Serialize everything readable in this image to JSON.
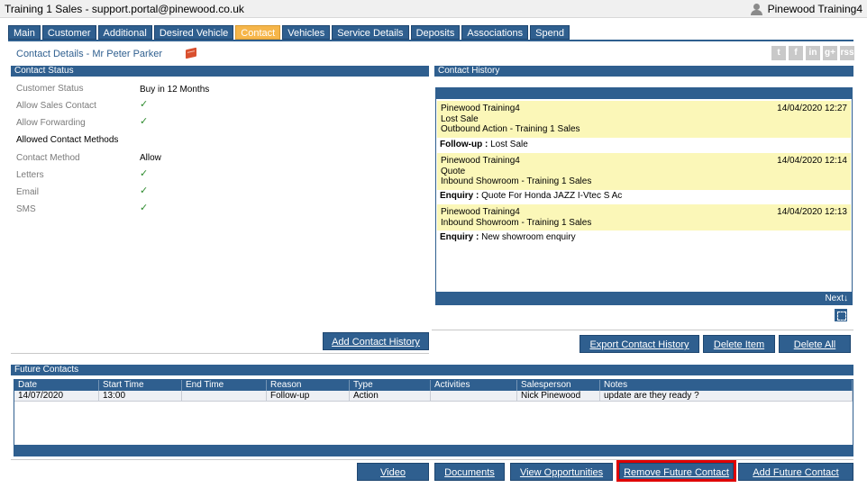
{
  "window": {
    "title": "Training 1 Sales - support.portal@pinewood.co.uk",
    "user": "Pinewood Training4"
  },
  "tabs": [
    "Main",
    "Customer",
    "Additional",
    "Desired Vehicle",
    "Contact",
    "Vehicles",
    "Service Details",
    "Deposits",
    "Associations",
    "Spend"
  ],
  "active_tab": "Contact",
  "contact_header": "Contact Details  - Mr Peter Parker",
  "social": [
    "t",
    "f",
    "in",
    "g+",
    "rss"
  ],
  "contact_status": {
    "title": "Contact Status",
    "customer_status_label": "Customer Status",
    "customer_status_value": "Buy in 12 Months",
    "allow_sales_label": "Allow Sales Contact",
    "allow_forwarding_label": "Allow Forwarding",
    "allowed_methods_label": "Allowed Contact Methods",
    "contact_method_label": "Contact Method",
    "contact_method_value": "Allow",
    "letters_label": "Letters",
    "email_label": "Email",
    "sms_label": "SMS",
    "check": "✓"
  },
  "contact_history": {
    "title": "Contact History",
    "entries": [
      {
        "user": "Pinewood Training4",
        "date": "14/04/2020 12:27",
        "line2": "Lost Sale",
        "line3": "Outbound Action - Training 1 Sales",
        "note_label": "Follow-up :",
        "note": "Lost Sale"
      },
      {
        "user": "Pinewood Training4",
        "date": "14/04/2020 12:14",
        "line2": "Quote",
        "line3": "Inbound Showroom - Training 1 Sales",
        "note_label": "Enquiry :",
        "note": "Quote For Honda JAZZ I-Vtec S Ac"
      },
      {
        "user": "Pinewood Training4",
        "date": "14/04/2020 12:13",
        "line2": "Inbound Showroom - Training 1 Sales",
        "line3": "",
        "note_label": "Enquiry :",
        "note": "New showroom enquiry"
      }
    ],
    "next": "Next↓"
  },
  "buttons": {
    "add_contact_history": "Add Contact History",
    "export_contact_history": "Export Contact History",
    "delete_item": "Delete Item",
    "delete_all": "Delete All",
    "video": "Video",
    "documents": "Documents",
    "view_opportunities": "View Opportunities",
    "remove_future_contact": "Remove Future Contact",
    "add_future_contact": "Add Future Contact"
  },
  "future_contacts": {
    "title": "Future Contacts",
    "columns": [
      "Date",
      "Start Time",
      "End Time",
      "Reason",
      "Type",
      "Activities",
      "Salesperson",
      "Notes"
    ],
    "rows": [
      [
        "14/07/2020",
        "13:00",
        "",
        "Follow-up",
        "Action",
        "",
        "Nick Pinewood",
        "update are they ready ?"
      ]
    ]
  }
}
